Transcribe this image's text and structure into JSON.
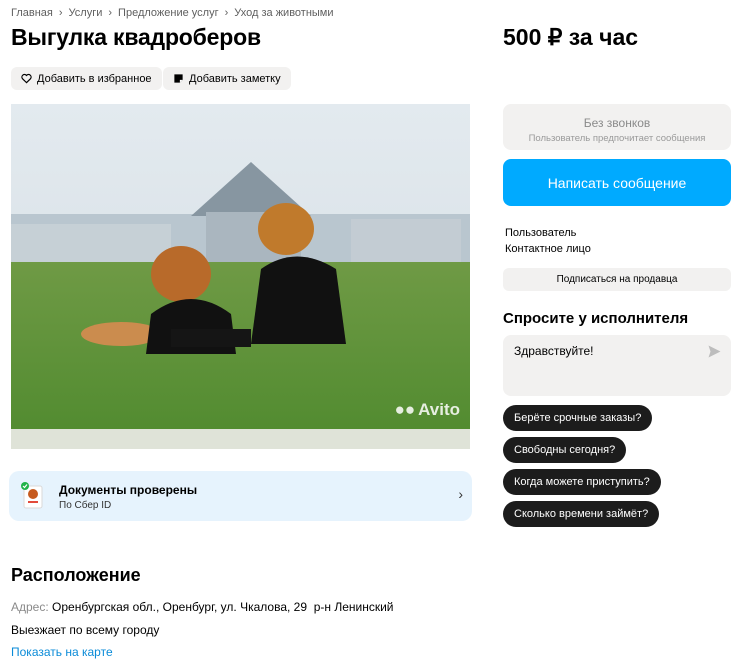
{
  "breadcrumbs": [
    "Главная",
    "Услуги",
    "Предложение услуг",
    "Уход за животными"
  ],
  "title": "Выгулка квадроберов",
  "price": "500 ₽ за час",
  "actions": {
    "favorite": "Добавить в избранное",
    "note": "Добавить заметку"
  },
  "photo": {
    "watermark": "Avito"
  },
  "docs": {
    "title": "Документы проверены",
    "subtitle": "По Сбер ID"
  },
  "location": {
    "heading": "Расположение",
    "address_label": "Адрес:",
    "address": "Оренбургская обл., Оренбург, ул. Чкалова, 29",
    "district": "р-н Ленинский",
    "travel": "Выезжает по всему городу",
    "map_link": "Показать на карте"
  },
  "contact": {
    "no_calls": "Без звонков",
    "prefers_messages": "Пользователь предпочитает сообщения",
    "write_button": "Написать сообщение",
    "seller_name": "Пользователь",
    "seller_role": "Контактное лицо",
    "subscribe": "Подписаться на продавца"
  },
  "ask": {
    "heading": "Спросите у исполнителя",
    "message": "Здравствуйте!",
    "quick_questions": [
      "Берёте срочные заказы?",
      "Свободны сегодня?",
      "Когда можете приступить?",
      "Сколько времени займёт?"
    ]
  },
  "colors": {
    "accent": "#00aaff",
    "link": "#0a8bd8",
    "chip": "#f2f1f0",
    "dark_chip": "#1c1c1c",
    "docs_bg": "#e6f3fd"
  }
}
